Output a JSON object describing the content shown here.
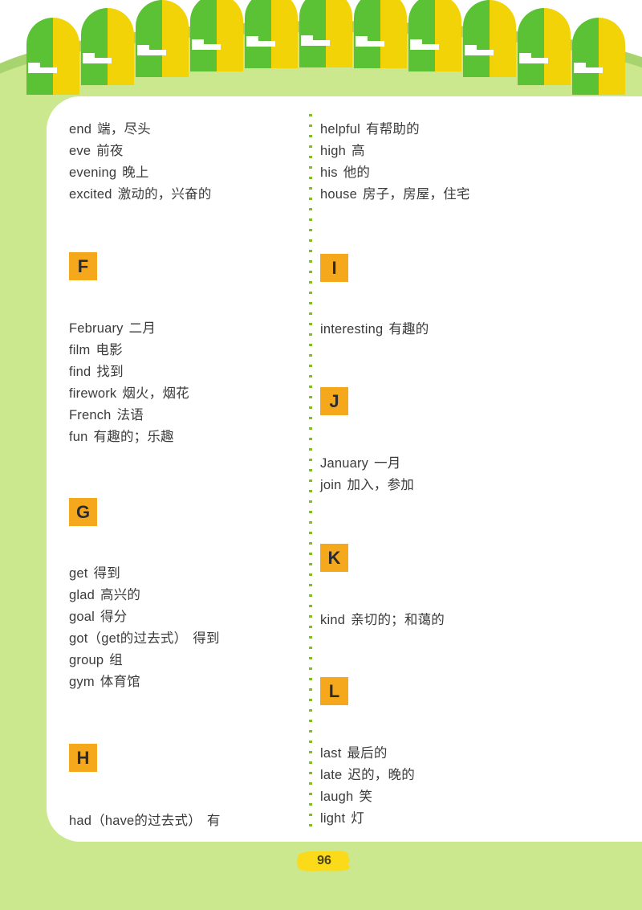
{
  "page": {
    "number": "96",
    "kind": "vocabulary-glossary"
  },
  "colors": {
    "background_green": "#CBE88F",
    "hill_dark_green": "#A8D46F",
    "card_white": "#FFFFFF",
    "badge_orange": "#F6A81C",
    "ring_green": "#5BC236",
    "ring_yellow": "#F2D307",
    "dot_green": "#82BE28",
    "brush_yellow": "#FBDA1A",
    "text_dark": "#3B3B3B"
  },
  "left_column": {
    "entries_top": [
      {
        "en": "end",
        "zh": "端，尽头"
      },
      {
        "en": "eve",
        "zh": "前夜"
      },
      {
        "en": "evening",
        "zh": "晚上"
      },
      {
        "en": "excited",
        "zh": "激动的，兴奋的"
      }
    ],
    "section_f": {
      "letter": "F"
    },
    "entries_f": [
      {
        "en": "February",
        "zh": "二月"
      },
      {
        "en": "film",
        "zh": "电影"
      },
      {
        "en": "find",
        "zh": "找到"
      },
      {
        "en": "firework",
        "zh": "烟火，烟花"
      },
      {
        "en": "French",
        "zh": "法语"
      },
      {
        "en": "fun",
        "zh": "有趣的；乐趣"
      }
    ],
    "section_g": {
      "letter": "G"
    },
    "entries_g": [
      {
        "en": "get",
        "zh": "得到"
      },
      {
        "en": "glad",
        "zh": "高兴的"
      },
      {
        "en": "goal",
        "zh": "得分"
      },
      {
        "en": "got（get的过去式）",
        "zh": "得到"
      },
      {
        "en": "group",
        "zh": "组"
      },
      {
        "en": "gym",
        "zh": "体育馆"
      }
    ],
    "section_h": {
      "letter": "H"
    },
    "entries_h": [
      {
        "en": "had（have的过去式）",
        "zh": "有"
      }
    ]
  },
  "right_column": {
    "entries_top": [
      {
        "en": "helpful",
        "zh": "有帮助的"
      },
      {
        "en": "high",
        "zh": "高"
      },
      {
        "en": "his",
        "zh": "他的"
      },
      {
        "en": "house",
        "zh": "房子，房屋，住宅"
      }
    ],
    "section_i": {
      "letter": "I"
    },
    "entries_i": [
      {
        "en": "interesting",
        "zh": "有趣的"
      }
    ],
    "section_j": {
      "letter": "J"
    },
    "entries_j": [
      {
        "en": "January",
        "zh": "一月"
      },
      {
        "en": "join",
        "zh": "加入，参加"
      }
    ],
    "section_k": {
      "letter": "K"
    },
    "entries_k": [
      {
        "en": "kind",
        "zh": "亲切的；和蔼的"
      }
    ],
    "section_l": {
      "letter": "L"
    },
    "entries_l": [
      {
        "en": "last",
        "zh": "最后的"
      },
      {
        "en": "late",
        "zh": "迟的，晚的"
      },
      {
        "en": "laugh",
        "zh": "笑"
      },
      {
        "en": "light",
        "zh": "灯"
      }
    ]
  },
  "decoration": {
    "binding_ring_count": 11
  }
}
